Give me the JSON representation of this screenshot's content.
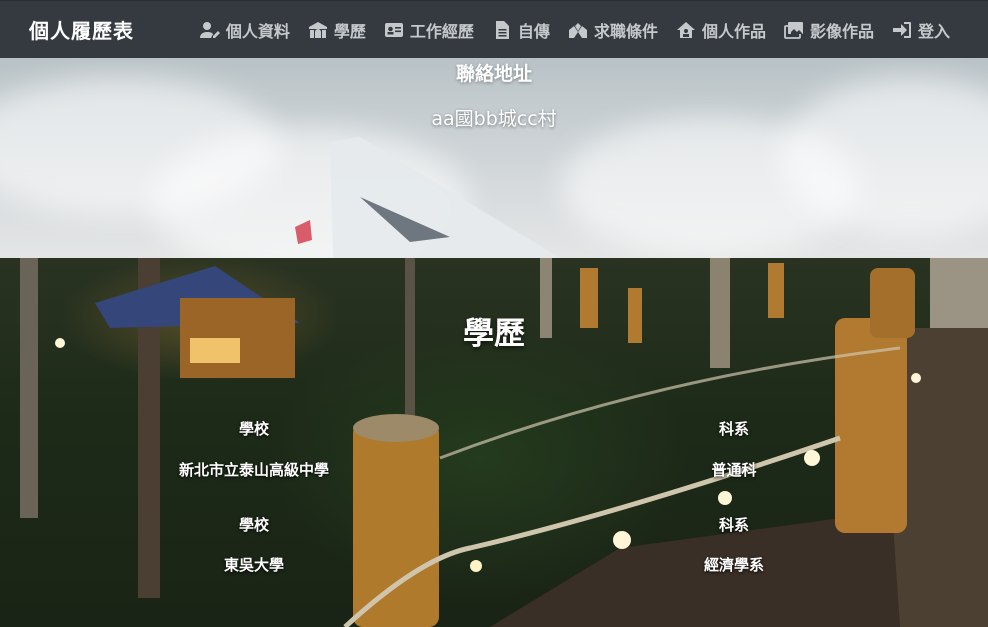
{
  "navbar": {
    "brand": "個人履歷表",
    "items": [
      {
        "label": "個人資料",
        "icon": "user-edit-icon"
      },
      {
        "label": "學歷",
        "icon": "school-icon"
      },
      {
        "label": "工作經歷",
        "icon": "id-card-icon"
      },
      {
        "label": "自傳",
        "icon": "document-icon"
      },
      {
        "label": "求職條件",
        "icon": "handshake-icon"
      },
      {
        "label": "個人作品",
        "icon": "house-user-icon"
      },
      {
        "label": "影像作品",
        "icon": "images-icon"
      },
      {
        "label": "登入",
        "icon": "sign-in-icon"
      }
    ]
  },
  "contact": {
    "title": "聯絡地址",
    "address": "aa國bb城cc村"
  },
  "education": {
    "title": "學歷",
    "school_header": "學校",
    "dept_header": "科系",
    "records": [
      {
        "school": "新北市立泰山高級中學",
        "department": "普通科"
      },
      {
        "school": "東吳大學",
        "department": "經濟學系"
      }
    ]
  }
}
